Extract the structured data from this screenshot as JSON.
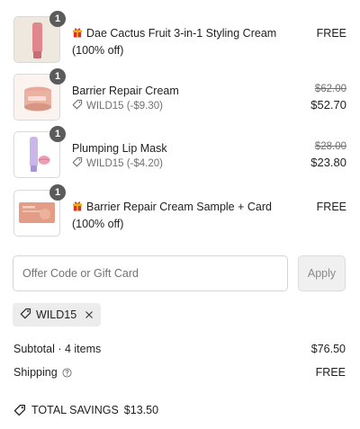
{
  "items": [
    {
      "qty": "1",
      "name": "Dae Cactus Fruit 3-in-1 Styling Cream (100% off)",
      "gift": true,
      "price": "FREE",
      "image_icon": "pink-tube-product-image"
    },
    {
      "qty": "1",
      "name": "Barrier Repair Cream",
      "gift": false,
      "discount": "WILD15 (-$9.30)",
      "original_price": "$62.00",
      "price": "$52.70",
      "image_icon": "cream-jar-product-image"
    },
    {
      "qty": "1",
      "name": "Plumping Lip Mask",
      "gift": false,
      "discount": "WILD15 (-$4.20)",
      "original_price": "$28.00",
      "price": "$23.80",
      "image_icon": "lip-mask-tube-product-image"
    },
    {
      "qty": "1",
      "name": "Barrier Repair Cream Sample + Card (100% off)",
      "gift": true,
      "price": "FREE",
      "image_icon": "sample-packet-product-image"
    }
  ],
  "offer": {
    "placeholder": "Offer Code or Gift Card",
    "apply_label": "Apply"
  },
  "applied_code": {
    "code": "WILD15"
  },
  "summary": {
    "subtotal_label": "Subtotal · 4 items",
    "subtotal_value": "$76.50",
    "shipping_label": "Shipping",
    "shipping_value": "FREE",
    "savings_label": "TOTAL SAVINGS",
    "savings_value": "$13.50"
  },
  "colors": {
    "badge": "#5b5b5b",
    "gift_red": "#d9312b",
    "gift_gold": "#e8b10e"
  }
}
